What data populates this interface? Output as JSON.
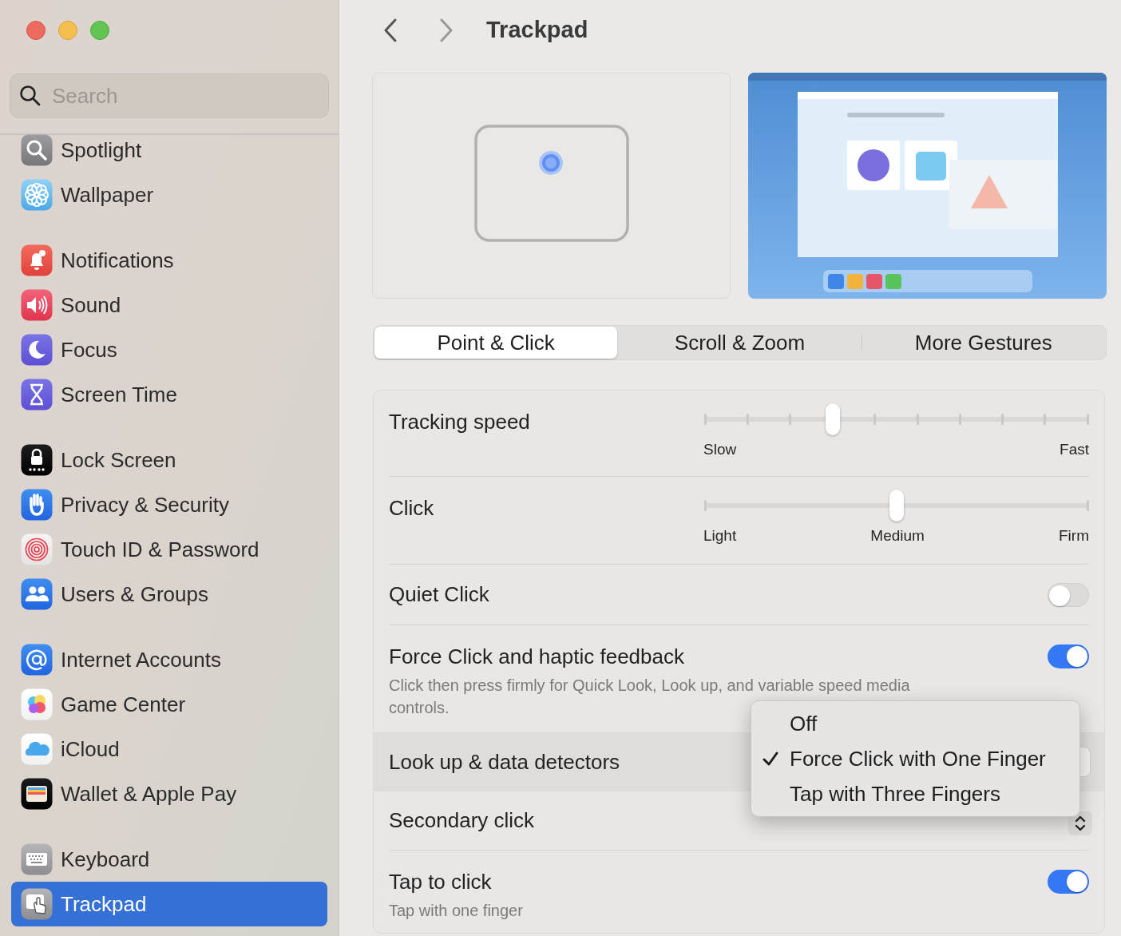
{
  "window": {
    "title": "Trackpad"
  },
  "sidebar": {
    "search": {
      "placeholder": "Search"
    },
    "groups": [
      [
        {
          "label": "Spotlight",
          "selected": false
        },
        {
          "label": "Wallpaper",
          "selected": false
        }
      ],
      [
        {
          "label": "Notifications",
          "selected": false
        },
        {
          "label": "Sound",
          "selected": false
        },
        {
          "label": "Focus",
          "selected": false
        },
        {
          "label": "Screen Time",
          "selected": false
        }
      ],
      [
        {
          "label": "Lock Screen",
          "selected": false
        },
        {
          "label": "Privacy & Security",
          "selected": false
        },
        {
          "label": "Touch ID & Password",
          "selected": false
        },
        {
          "label": "Users & Groups",
          "selected": false
        }
      ],
      [
        {
          "label": "Internet Accounts",
          "selected": false
        },
        {
          "label": "Game Center",
          "selected": false
        },
        {
          "label": "iCloud",
          "selected": false
        },
        {
          "label": "Wallet & Apple Pay",
          "selected": false
        }
      ],
      [
        {
          "label": "Keyboard",
          "selected": false
        },
        {
          "label": "Trackpad",
          "selected": true
        }
      ]
    ]
  },
  "tabs": [
    {
      "label": "Point & Click",
      "selected": true
    },
    {
      "label": "Scroll & Zoom",
      "selected": false
    },
    {
      "label": "More Gestures",
      "selected": false
    }
  ],
  "settings": [
    {
      "kind": "stepped-slider",
      "label": "Tracking speed",
      "level": 0.333,
      "labels": [
        "Slow",
        "Fast"
      ]
    },
    {
      "kind": "slider",
      "label": "Click",
      "level": 0.5,
      "labels": [
        "Light",
        "Medium",
        "Firm"
      ]
    },
    {
      "kind": "toggle",
      "label": "Quiet Click",
      "on": false
    },
    {
      "kind": "toggle",
      "label": "Force Click and haptic feedback",
      "description": "Click then press firmly for Quick Look, Look up, and variable speed media controls.",
      "on": true
    },
    {
      "kind": "popup",
      "label": "Look up & data detectors",
      "expanded": true,
      "options": [
        {
          "label": "Off",
          "selected": false
        },
        {
          "label": "Force Click with One Finger",
          "selected": true
        },
        {
          "label": "Tap with Three Fingers",
          "selected": false
        }
      ]
    },
    {
      "kind": "popup",
      "label": "Secondary click",
      "expanded": false
    },
    {
      "kind": "toggle",
      "label": "Tap to click",
      "description": "Tap with one finger",
      "on": true
    }
  ]
}
